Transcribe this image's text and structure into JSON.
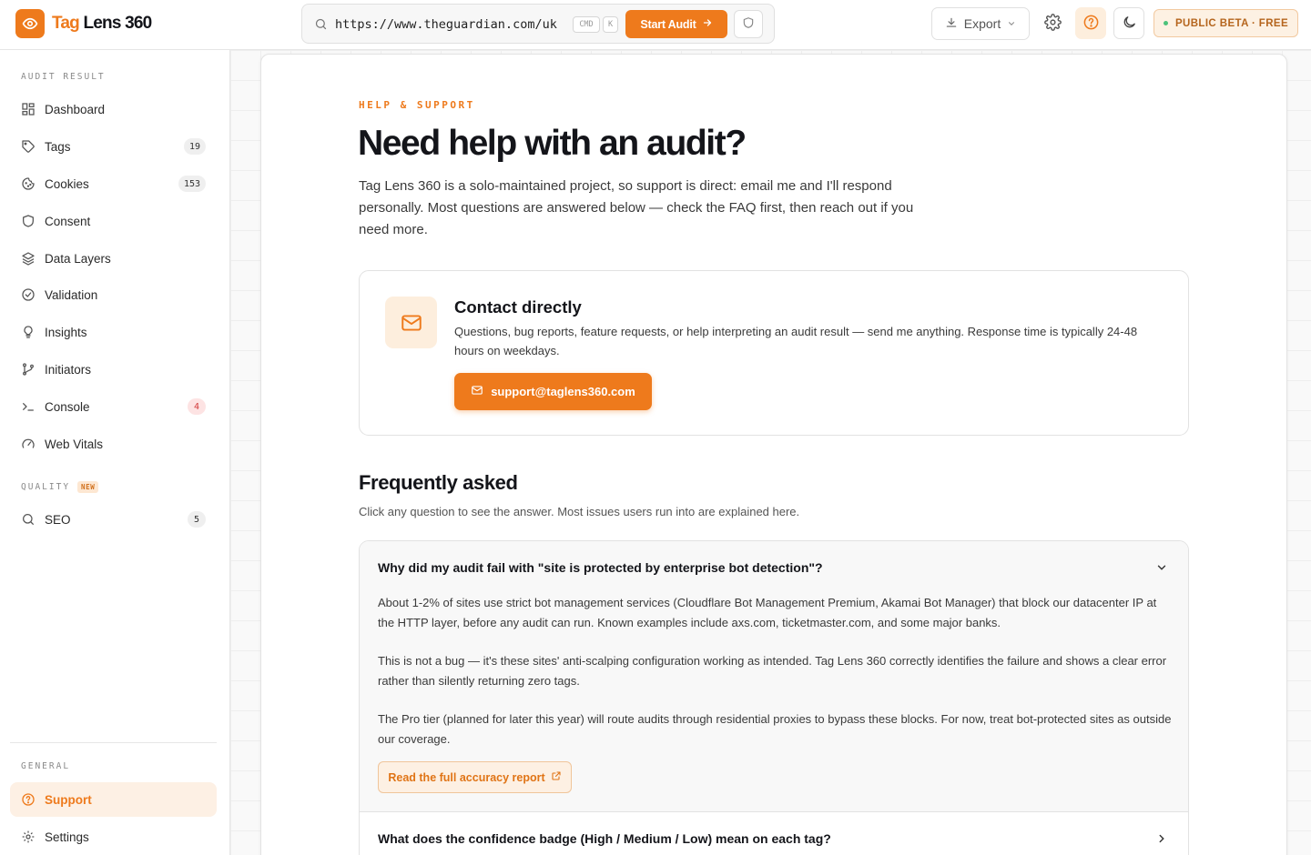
{
  "app": {
    "name_part1": "Tag",
    "name_part2": " Lens 360",
    "accent_color": "#ee7a1c"
  },
  "header": {
    "url_value": "https://www.theguardian.com/uk",
    "kbd_cmd": "CMD",
    "kbd_k": "K",
    "start_audit_label": "Start Audit",
    "export_label": "Export",
    "beta_label": "PUBLIC BETA · FREE",
    "icons": [
      "search-icon",
      "arrow-right-icon",
      "shield-icon",
      "download-icon",
      "chevron-down-icon",
      "gear-icon",
      "help-icon",
      "moon-icon"
    ]
  },
  "sidebar": {
    "section_audit": "AUDIT RESULT",
    "section_quality": "QUALITY",
    "quality_badge": "NEW",
    "section_general": "GENERAL",
    "items": [
      {
        "label": "Dashboard",
        "icon": "dashboard-icon"
      },
      {
        "label": "Tags",
        "count": "19",
        "icon": "tag-icon"
      },
      {
        "label": "Cookies",
        "count": "153",
        "icon": "cookie-icon"
      },
      {
        "label": "Consent",
        "icon": "shield-icon"
      },
      {
        "label": "Data Layers",
        "icon": "layers-icon"
      },
      {
        "label": "Validation",
        "icon": "check-circle-icon"
      },
      {
        "label": "Insights",
        "icon": "lightbulb-icon"
      },
      {
        "label": "Initiators",
        "icon": "git-branch-icon"
      },
      {
        "label": "Console",
        "count": "4",
        "icon": "terminal-icon"
      },
      {
        "label": "Web Vitals",
        "icon": "gauge-icon"
      }
    ],
    "quality_items": [
      {
        "label": "SEO",
        "count": "5",
        "icon": "search-icon"
      }
    ],
    "general_items": [
      {
        "label": "Support",
        "icon": "help-icon",
        "active": true
      },
      {
        "label": "Settings",
        "icon": "gear-icon"
      }
    ]
  },
  "main": {
    "eyebrow": "HELP & SUPPORT",
    "title": "Need help with an audit?",
    "intro": "Tag Lens 360 is a solo-maintained project, so support is direct: email me and I'll respond personally. Most questions are answered below — check the FAQ first, then reach out if you need more.",
    "contact": {
      "title": "Contact directly",
      "description": "Questions, bug reports, feature requests, or help interpreting an audit result — send me anything. Response time is typically 24-48 hours on weekdays.",
      "email": "support@taglens360.com"
    },
    "faq": {
      "title": "Frequently asked",
      "subtitle": "Click any question to see the answer. Most issues users run into are explained here.",
      "items": [
        {
          "question": "Why did my audit fail with \"site is protected by enterprise bot detection\"?",
          "expanded": true,
          "paragraphs": [
            "About 1-2% of sites use strict bot management services (Cloudflare Bot Management Premium, Akamai Bot Manager) that block our datacenter IP at the HTTP layer, before any audit can run. Known examples include axs.com, ticketmaster.com, and some major banks.",
            "This is not a bug — it's these sites' anti-scalping configuration working as intended. Tag Lens 360 correctly identifies the failure and shows a clear error rather than silently returning zero tags.",
            "The Pro tier (planned for later this year) will route audits through residential proxies to bypass these blocks. For now, treat bot-protected sites as outside our coverage."
          ],
          "link_label": "Read the full accuracy report"
        },
        {
          "question": "What does the confidence badge (High / Medium / Low) mean on each tag?",
          "expanded": false
        }
      ]
    }
  }
}
